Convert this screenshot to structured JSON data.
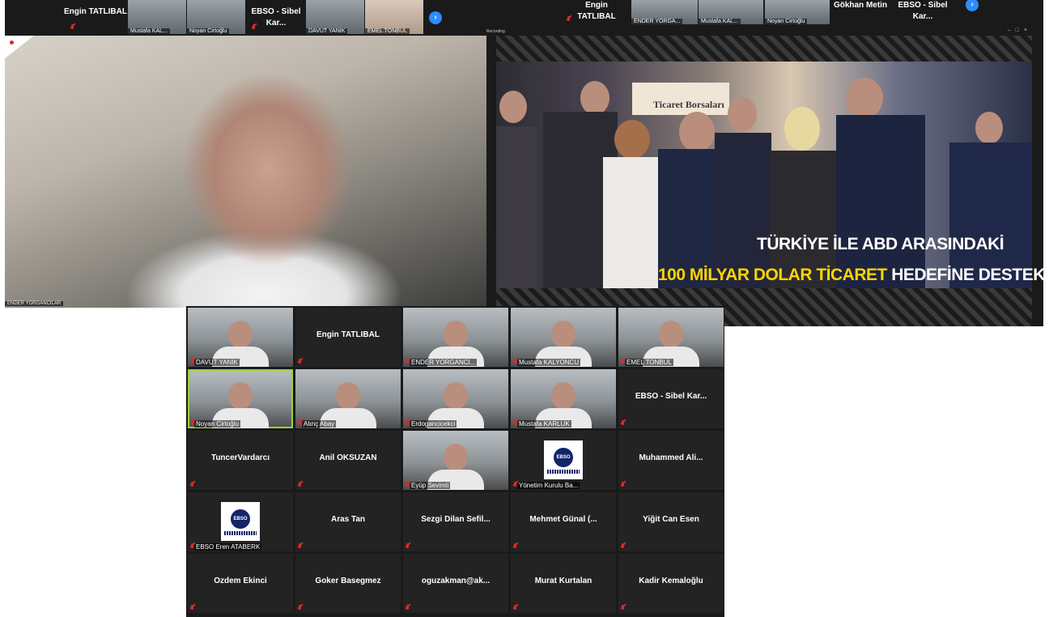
{
  "top_left": {
    "strip": {
      "name_tile": "Engin TATLIBAL",
      "thumbs": [
        "Mustafa KAL...",
        "Noyan Cirtoğlu",
        "DAVUT YANIK",
        "EMEL TONBUL"
      ],
      "name_tile2": "EBSO - Sibel Kar..."
    },
    "video_label": "ENDER YORGANCILAR"
  },
  "top_right": {
    "strip": {
      "name_tile": "Engin TATLIBAL",
      "thumbs": [
        "ENDER YORGA...",
        "Mustafa KAL...",
        "Noyan Cirtoğlu"
      ],
      "name_tile2": "Gökhan Metin",
      "name_tile3": "EBSO - Sibel Kar..."
    },
    "recording_label": "Recording",
    "sign": "Ticaret Borsaları",
    "headline_line1": "TÜRKİYE İLE ABD ARASINDAKİ",
    "headline_line2_yellow": "100 MİLYAR DOLAR TİCARET",
    "headline_line2_white": "HEDEFİNE DESTEK"
  },
  "gallery": {
    "tiles": [
      {
        "type": "video",
        "label": "DAVUT YANIK"
      },
      {
        "type": "name",
        "name": "Engin TATLIBAL"
      },
      {
        "type": "video",
        "label": "ENDER YORGANCI..."
      },
      {
        "type": "video",
        "label": "Mustafa KALYONCU"
      },
      {
        "type": "video",
        "label": "EMEL TONBUL"
      },
      {
        "type": "video",
        "label": "Noyan Cirtoğlu"
      },
      {
        "type": "video",
        "label": "Atınç Abay"
      },
      {
        "type": "video",
        "label": "Erdogancicekci"
      },
      {
        "type": "video",
        "label": "Mustafa KARLUK"
      },
      {
        "type": "name",
        "name": "EBSO - Sibel Kar..."
      },
      {
        "type": "name",
        "name": "TuncerVardarcı"
      },
      {
        "type": "name",
        "name": "Anil OKSUZAN"
      },
      {
        "type": "video",
        "label": "Eyüp Sevimli"
      },
      {
        "type": "logo",
        "label": "Yönetim Kurulu Ba..."
      },
      {
        "type": "name",
        "name": "Muhammed Ali..."
      },
      {
        "type": "logo",
        "label": "EBSO Eren ATABERK"
      },
      {
        "type": "name",
        "name": "Aras Tan"
      },
      {
        "type": "name",
        "name": "Sezgi Dilan Sefil..."
      },
      {
        "type": "name",
        "name": "Mehmet Günal (..."
      },
      {
        "type": "name",
        "name": "Yiğit Can Esen"
      },
      {
        "type": "name",
        "name": "Özdem Ekinci"
      },
      {
        "type": "name",
        "name": "Goker Basegmez"
      },
      {
        "type": "name",
        "name": "oguzakman@ak..."
      },
      {
        "type": "name",
        "name": "Murat Kurtalan"
      },
      {
        "type": "name",
        "name": "Kadir Kemaloğlu"
      }
    ],
    "logo_text": "EBSO"
  },
  "colors": {
    "tile_bg": "#232323",
    "mic": "#e02828",
    "accent": "#2d8cff",
    "active_border": "#9bd23c",
    "headline_yellow": "#ffd400"
  },
  "icons": {
    "mic": "muted-mic-icon",
    "next": "chevron-right-icon"
  }
}
